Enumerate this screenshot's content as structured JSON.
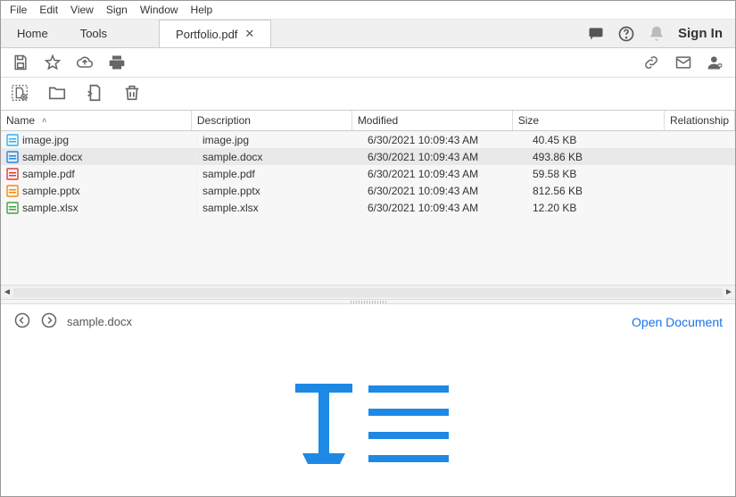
{
  "menubar": [
    "File",
    "Edit",
    "View",
    "Sign",
    "Window",
    "Help"
  ],
  "tabs": {
    "home": "Home",
    "tools": "Tools",
    "doc": "Portfolio.pdf"
  },
  "signin": "Sign In",
  "columns": {
    "name": "Name",
    "description": "Description",
    "modified": "Modified",
    "size": "Size",
    "relationship": "Relationship"
  },
  "rows": [
    {
      "name": "image.jpg",
      "desc": "image.jpg",
      "mod": "6/30/2021 10:09:43 AM",
      "size": "40.45 KB",
      "type": "jpg",
      "selected": false
    },
    {
      "name": "sample.docx",
      "desc": "sample.docx",
      "mod": "6/30/2021 10:09:43 AM",
      "size": "493.86 KB",
      "type": "docx",
      "selected": true
    },
    {
      "name": "sample.pdf",
      "desc": "sample.pdf",
      "mod": "6/30/2021 10:09:43 AM",
      "size": "59.58 KB",
      "type": "pdf",
      "selected": false
    },
    {
      "name": "sample.pptx",
      "desc": "sample.pptx",
      "mod": "6/30/2021 10:09:43 AM",
      "size": "812.56 KB",
      "type": "pptx",
      "selected": false
    },
    {
      "name": "sample.xlsx",
      "desc": "sample.xlsx",
      "mod": "6/30/2021 10:09:43 AM",
      "size": "12.20 KB",
      "type": "xlsx",
      "selected": false
    }
  ],
  "preview": {
    "filename": "sample.docx",
    "open": "Open Document"
  }
}
